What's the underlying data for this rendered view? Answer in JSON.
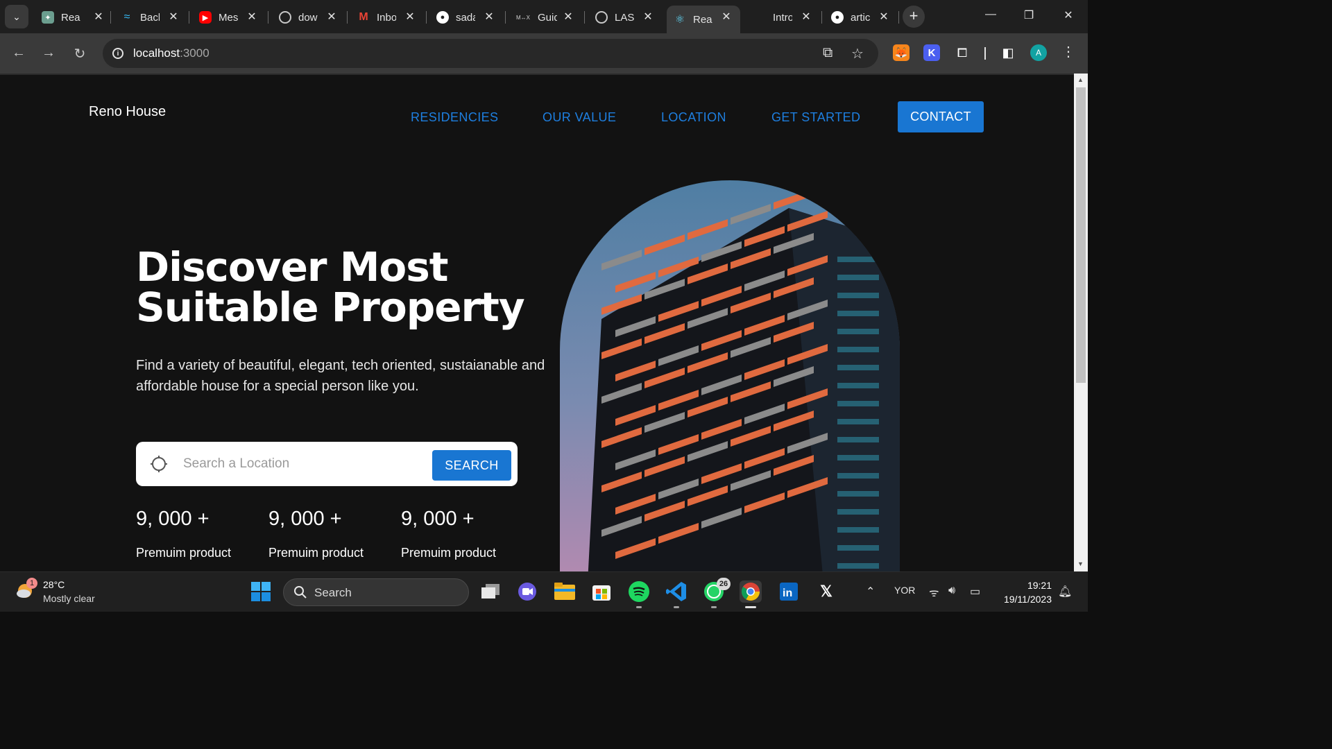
{
  "browser": {
    "tabs": [
      {
        "title": "React",
        "favicon": "chatgpt-icon",
        "color": "#6b9e8f"
      },
      {
        "title": "Backend",
        "favicon": "tailwind-icon",
        "color": "#38bdf8"
      },
      {
        "title": "Messages",
        "favicon": "youtube-icon",
        "color": "#ff0000"
      },
      {
        "title": "download",
        "favicon": "globe-icon",
        "color": "#9a9a9a"
      },
      {
        "title": "Inbox",
        "favicon": "gmail-icon",
        "color": "#ea4335"
      },
      {
        "title": "sadat",
        "favicon": "github-icon",
        "color": "#ffffff"
      },
      {
        "title": "Guide",
        "favicon": "mui-icon",
        "color": "#cfcfcf"
      },
      {
        "title": "LAST",
        "favicon": "globe-icon",
        "color": "#9a9a9a"
      },
      {
        "title": "React",
        "favicon": "react-icon",
        "color": "#61dafb",
        "active": true
      },
      {
        "title": "Intro",
        "favicon": "",
        "color": "#1f1f1f"
      },
      {
        "title": "article",
        "favicon": "github-icon",
        "color": "#ffffff"
      }
    ],
    "url_host": "localhost",
    "url_port": ":3000",
    "profile_initial": "A"
  },
  "page": {
    "brand": "Reno House",
    "nav": [
      "RESIDENCIES",
      "OUR VALUE",
      "LOCATION",
      "GET STARTED"
    ],
    "contact_label": "CONTACT",
    "hero_title_line1": "Discover Most",
    "hero_title_line2": "Suitable Property",
    "hero_description": "Find a variety of beautiful, elegant, tech oriented, sustaianable and affordable house for a special person like you.",
    "search_placeholder": "Search a Location",
    "search_button": "SEARCH",
    "stats": [
      {
        "value": "9, 000 +",
        "label": "Premuim product"
      },
      {
        "value": "9, 000 +",
        "label": "Premuim product"
      },
      {
        "value": "9, 000 +",
        "label": "Premuim product"
      }
    ],
    "accent_color": "#1976d2"
  },
  "taskbar": {
    "weather_badge": "1",
    "temperature": "28°C",
    "condition": "Mostly clear",
    "search_label": "Search",
    "whatsapp_badge": "26",
    "language": "YOR",
    "time": "19:21",
    "date": "19/11/2023"
  }
}
